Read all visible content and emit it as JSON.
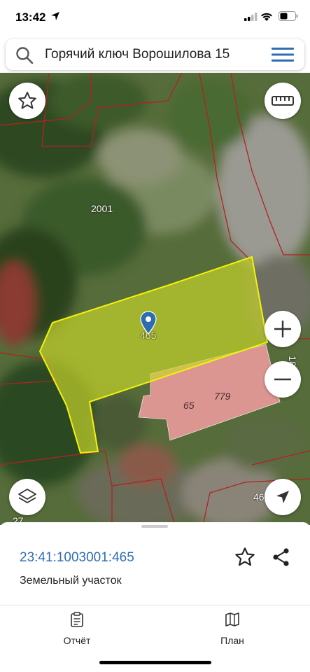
{
  "status": {
    "time": "13:42"
  },
  "search": {
    "value": "Горячий ключ Ворошилова 15",
    "placeholder": ""
  },
  "map": {
    "parcel_labels": {
      "p2001": "2001",
      "p465": "465",
      "p779": "779",
      "p65": "65",
      "p46": "46",
      "p27": "27",
      "p18": "18"
    }
  },
  "sheet": {
    "cadastral_number": "23:41:1003001:465",
    "object_type": "Земельный участок",
    "tabs": [
      {
        "label": "Отчёт",
        "icon": "report-icon"
      },
      {
        "label": "План",
        "icon": "map-icon"
      }
    ]
  },
  "colors": {
    "accent": "#2f6db3",
    "selected_parcel_fill": "#c8d62a",
    "selected_parcel_stroke": "#f2f20a",
    "building_fill": "#e79a9a",
    "boundary": "#b22222"
  }
}
